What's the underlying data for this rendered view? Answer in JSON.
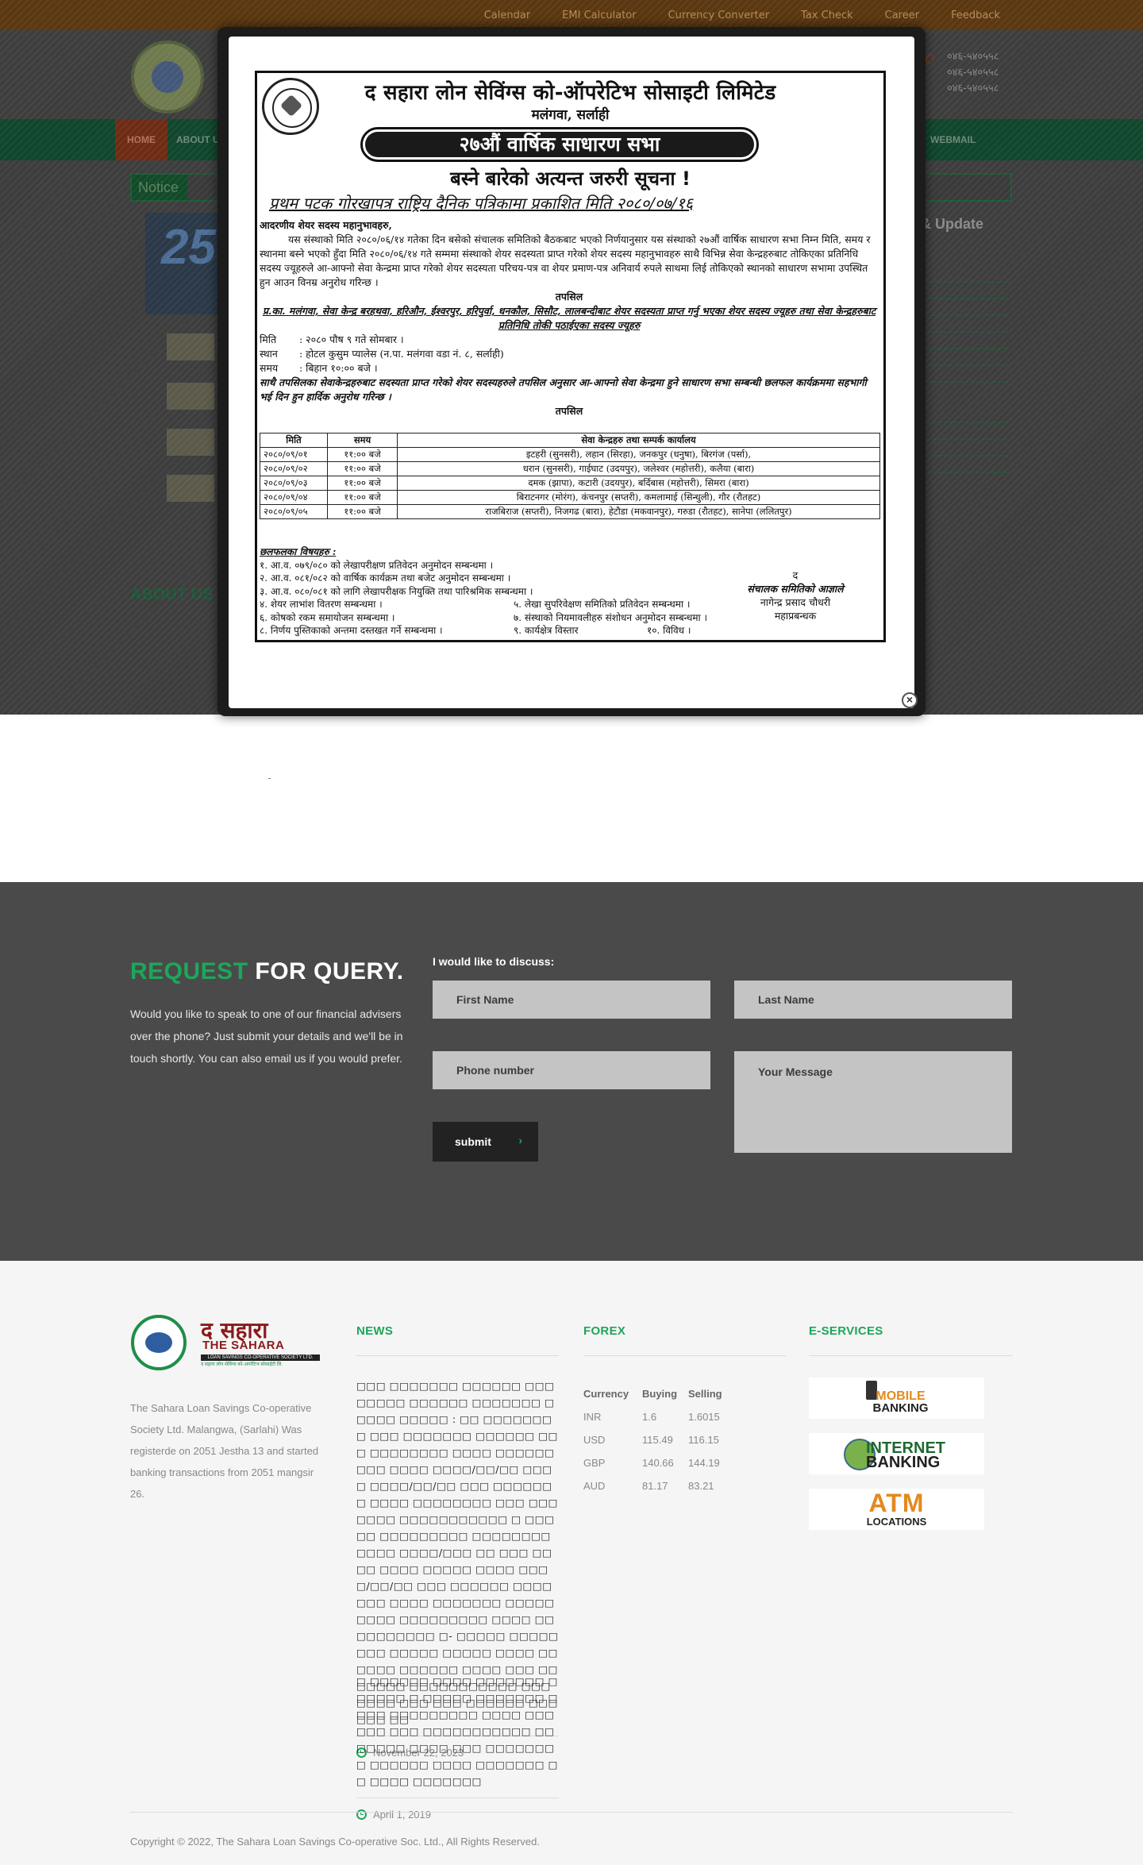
{
  "topbar": {
    "links": [
      "Calendar",
      "EMI Calculator",
      "Currency Converter",
      "Tax Check",
      "Career",
      "Feedback"
    ]
  },
  "nav": {
    "home": "HOME",
    "about": "ABOUT U",
    "webmail": "WEBMAIL"
  },
  "notice_bar_label": "Notice",
  "bg_news_title": "s & Update",
  "bg_about_title": "ABOUT US",
  "bg_phone_lines": [
    "०४६-५४०५५८",
    "०४६-५४०५५८",
    "०४६-५४०५५८"
  ],
  "bg_years": "25",
  "popup": {
    "title": "द सहारा लोन सेविंग्स को-ऑपरेटिभ सोसाइटी लिमिटेड",
    "location": "मलंगवा, सर्लाही",
    "banner": "२७औं वार्षिक साधारण सभा",
    "urgent": "बस्ने बारेको अत्यन्त जरुरी सूचना !",
    "published": "प्रथम पटक गोरखापत्र राष्ट्रिय दैनिक पत्रिकामा प्रकाशित मिति २०८०/०७/१६",
    "salutation": "आदरणीय शेयर सदस्य महानुभावहरु,",
    "paragraph": "यस संस्थाको मिति २०८०/०६/१४ गतेका दिन बसेको संचालक समितिको बैठकबाट भएको निर्णयानुसार यस संस्थाको २७औं वार्षिक साधारण सभा निम्न मिति, समय र स्थानमा बस्ने भएको हुँदा मिति २०८०/०६/१४ गते सम्ममा संस्थाको शेयर सदस्यता प्राप्त गरेको शेयर सदस्य महानुभावहरु साथै विभिन्न सेवा केन्द्रहरुबाट तोकिएका प्रतिनिधि सदस्य ज्यूहरुले आ-आफ्नो सेवा केन्द्रमा प्राप्त गरेको शेयर सदस्यता परिचय-पत्र वा शेयर प्रमाण-पत्र अनिवार्य रुपले साथमा लिई तोकिएको स्थानको साधारण सभामा उपस्थित हुन आउन विनम्र अनुरोध गरिन्छ ।",
    "tapsil1": "तपसिल",
    "branches": "प्र.का. मलंगवा, सेवा केन्द्र बरहथवा, हरिऔन, ईश्वरपुर, हरिपुर्वा, धनकौल, सिसौट, लालबन्दीबाट शेयर सदस्यता प्राप्त गर्नु भएका शेयर सदस्य ज्यूहरु तथा सेवा केन्द्रहरुबाट प्रतिनिधि तोकी पठाईएका सदस्य ज्यूहरु",
    "date_label": "मिति",
    "date_value": ": २०८० पौष ९ गते सोमबार ।",
    "place_label": "स्थान",
    "place_value": ": होटल कुसुम प्यालेस (न.पा. मलंगवा वडा नं. ८, सर्लाही)",
    "time_label": "समय",
    "time_value": ": बिहान १०:०० बजे ।",
    "note": "साथै तपसिलका सेवाकेन्द्रहरुबाट सदस्यता प्राप्त गरेको शेयर सदस्यहरुले तपसिल अनुसार आ-आफ्नो सेवा केन्द्रमा हुने साधारण सभा सम्बन्धी छलफल कार्यक्रममा सहभागी भई दिन हुन हार्दिक अनुरोध गरिन्छ ।",
    "tapsil2": "तपसिल",
    "table": {
      "headers": [
        "मिति",
        "समय",
        "सेवा केन्द्रहरु तथा सम्पर्क कार्यालय"
      ],
      "rows": [
        [
          "२०८०/०९/०१",
          "११:०० बजे",
          "इटहरी (सुनसरी), लहान (सिरहा), जनकपुर (धनुषा), बिरगंज (पर्सा),"
        ],
        [
          "२०८०/०९/०२",
          "११:०० बजे",
          "धरान (सुनसरी), गाईघाट (उदयपुर), जलेश्वर (महोत्तरी), कलैया (बारा)"
        ],
        [
          "२०८०/०९/०३",
          "११:०० बजे",
          "दमक (झापा), कटारी (उदयपुर), बर्दिबास (महोत्तरी), सिमरा (बारा)"
        ],
        [
          "२०८०/०९/०४",
          "११:०० बजे",
          "बिराटनगर (मोरंग), कंचनपुर (सप्तरी), कमलामाई (सिन्धुली), गौर (रौतहट)"
        ],
        [
          "२०८०/०९/०५",
          "११:०० बजे",
          "राजबिराज (सप्तरी), निजगढ (बारा), हेटौडा (मकवानपुर), गरुडा (रौतहट), सानेपा (ललितपुर)"
        ]
      ]
    },
    "agenda_title": "छलफलका विषयहरु :",
    "agenda": [
      "१. आ.व. ०७९/०८० को लेखापरीक्षण प्रतिवेदन अनुमोदन सम्बन्धमा ।",
      "२. आ.व. ०८१/०८२ को वार्षिक कार्यक्रम तथा बजेट अनुमोदन सम्बन्धमा ।",
      "३. आ.व. ०८०/०८१ को लागि लेखापरीक्षक नियुक्ति तथा पारिश्रमिक सम्बन्धमा ।",
      "४. शेयर लाभांश वितरण सम्बन्धमा ।",
      "५. लेखा सुपरिवेक्षण समितिको प्रतिवेदन सम्बन्धमा ।",
      "६. कोषको रकम समायोजन सम्बन्धमा ।",
      "७. संस्थाको नियमावलीहरु संशोधन अनुमोदन सम्बन्धमा ।",
      "८. निर्णय पुस्तिकाको अन्तमा दस्तखत गर्ने सम्बन्धमा ।",
      "९. कार्यक्षेत्र विस्तार",
      "१०. विविध ।"
    ],
    "sign": [
      "द",
      "संचालक समितिको आज्ञाले",
      "नागेन्द्र प्रसाद चौधरी",
      "महाप्रबन्धक"
    ],
    "close_symbol": "×"
  },
  "query": {
    "title_accent": "REQUEST",
    "title_rest": " FOR QUERY.",
    "text": "Would you like to speak to one of our financial advisers over the phone? Just submit your details and we'll be in touch shortly. You can also email us if you would prefer.",
    "label": "I would like to discuss:",
    "first_name": "First Name",
    "last_name": "Last Name",
    "phone": "Phone number",
    "message": "Your Message",
    "submit": "submit",
    "submit_arrow": "›"
  },
  "footer": {
    "logo_np": "द सहारा",
    "logo_en": "THE SAHARA",
    "logo_bar": "LOAN SAVINGS CO-OPERATIVE SOCIETY LTD.",
    "logo_sub": "द सहारा लोन सेविंग्स को-अपरेटिभ सोसाईटी लि.",
    "about": "The Sahara Loan Savings Co-operative Society Ltd. Malangwa, (Sarlahi) Was registerde on 2051 Jestha 13 and started banking transactions from 2051 mangsir 26.",
    "news_title": "NEWS",
    "forex_title": "FOREX",
    "eservices_title": "E-SERVICES",
    "news": [
      {
        "text": "□□□ □□□□□□□ □□□□□□ □□□ □□□□□ □□□□□□ □□□□□□□ □□□□□ □□□□□ : □□ □□□□□□□□ □□□ □□□□□□□ □□□□□□ □□□ □□□□□□□□ □□□□ □□□□□□□□□ □□□□ □□□□/□□/□□ □□□□ □□□□/□□/□□ □□□ □□□□□□□ □□□□ □□□□□□□□ □□□ □□□□□□□ □□□□□□□□□□□ □ □□□□□ □□□□□□□□□ □□□□□□□□ □□□□ □□□□/□□□ □□ □□□ □□□□ □□□□ □□□□□ □□□□ □□□□/□□/□□ □□□ □□□□□□ □□□□□□□ □□□□ □□□□□□□ □□□□□□□□□ □□□□□□□□□ □□□□ □□□□□□□□□□ □- □□□□□ □□□□□□□□ □□□□□ □□□□□ □□□□ □□ □□□□ □□□□□□ □□□□ □□□ □□□□□□□ □□□□□□□□□□□ □□□□□□□ □□□ □□□ □□□□□□ □□□□□□ □□",
        "date": "November 22, 2023"
      },
      {
        "text": "□ □□□□□□ □□□□ □□□□□□□ □□□□□□ □ □□□□□ □□□□□□□ □□□□ □□□□□□□□□ □□□□ □□□□□□ □□□ □□□□□□□□□□□ □□□□□□□ □□□□ □□□ □□□□□□□□ □□□□□□ □□□□ □□□□□□□ □ □ □□□□ □□□□□□□",
        "date": "April 1, 2019"
      }
    ],
    "forex": {
      "headers": [
        "Currency",
        "Buying",
        "Selling"
      ],
      "rows": [
        [
          "INR",
          "1.6",
          "1.6015"
        ],
        [
          "USD",
          "115.49",
          "116.15"
        ],
        [
          "GBP",
          "140.66",
          "144.19"
        ],
        [
          "AUD",
          "81.17",
          "83.21"
        ]
      ]
    },
    "eservices": {
      "mobile": [
        "MOBILE",
        "BANKING"
      ],
      "internet": [
        "INTERNET",
        "BANKING"
      ],
      "atm": [
        "ATM",
        "LOCATIONS"
      ]
    },
    "copyright": "Copyright © 2022, The Sahara Loan Savings Co-operative Soc. Ltd., All Rights Reserved."
  },
  "colors": {
    "accent_green": "#1ea65a",
    "query_bg": "#4a4a4a",
    "footer_bg": "#f5f5f5",
    "popup_frame": "#1c1c1c"
  }
}
